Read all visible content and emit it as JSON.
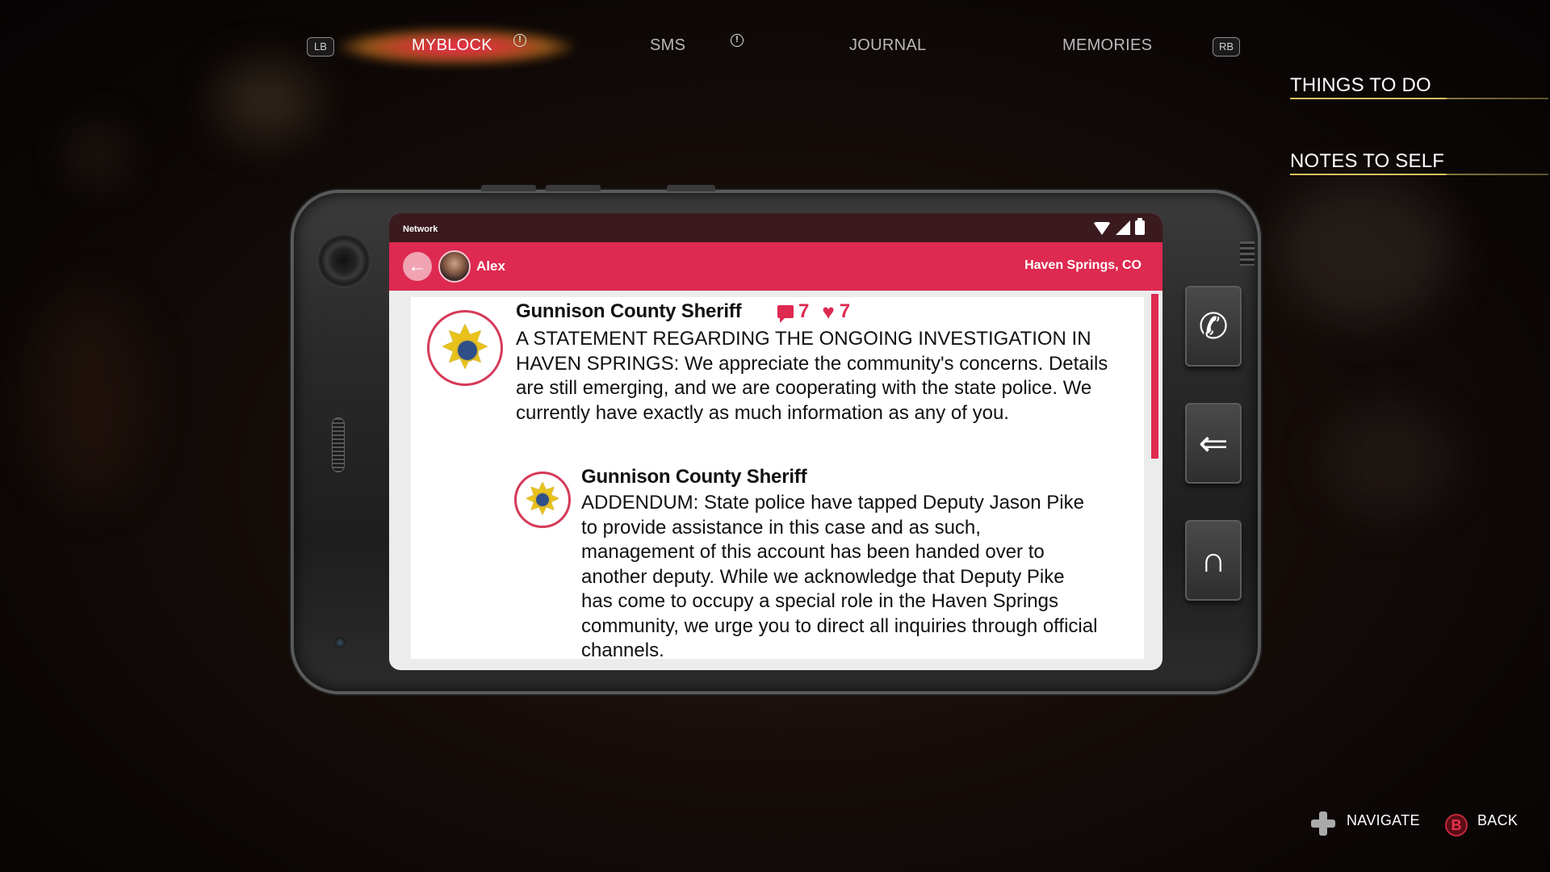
{
  "nav": {
    "lb": "LB",
    "rb": "RB",
    "tabs": [
      {
        "label": "MYBLOCK",
        "active": true
      },
      {
        "label": "SMS",
        "active": false
      },
      {
        "label": "JOURNAL",
        "active": false
      },
      {
        "label": "MEMORIES",
        "active": false
      }
    ],
    "info_glyph": "!"
  },
  "side_menu": {
    "items": [
      "THINGS TO DO",
      "NOTES TO SELF"
    ]
  },
  "phone": {
    "status_bar": {
      "carrier": "Network",
      "icons": [
        "wifi-icon",
        "signal-icon",
        "battery-icon"
      ]
    },
    "app_bar": {
      "back_icon": "←",
      "user": "Alex",
      "location": "Haven Springs, CO"
    },
    "posts": [
      {
        "author": "Gunnison County Sheriff",
        "comments": "7",
        "likes": "7",
        "body": "A STATEMENT REGARDING THE ONGOING INVESTIGATION IN HAVEN SPRINGS: We appreciate the community's concerns. Details are still emerging, and we are cooperating with the state police. We currently have exactly as much information as any of you."
      },
      {
        "author": "Gunnison County Sheriff",
        "body": "ADDENDUM: State police have tapped Deputy Jason Pike to provide assistance in this case and as such, management of this account has been handed over to another deputy. While we acknowledge that Deputy Pike has come to occupy a special role in the Haven Springs community, we urge you to direct all inquiries through official channels."
      }
    ],
    "side_buttons": [
      "phone-call-icon",
      "exit-app-icon",
      "return-icon"
    ]
  },
  "hints": {
    "navigate": "NAVIGATE",
    "back": "BACK",
    "back_key": "B"
  },
  "colors": {
    "accent": "#de2950",
    "status_bar": "#3a1a1e",
    "underline": "#d8c060"
  }
}
